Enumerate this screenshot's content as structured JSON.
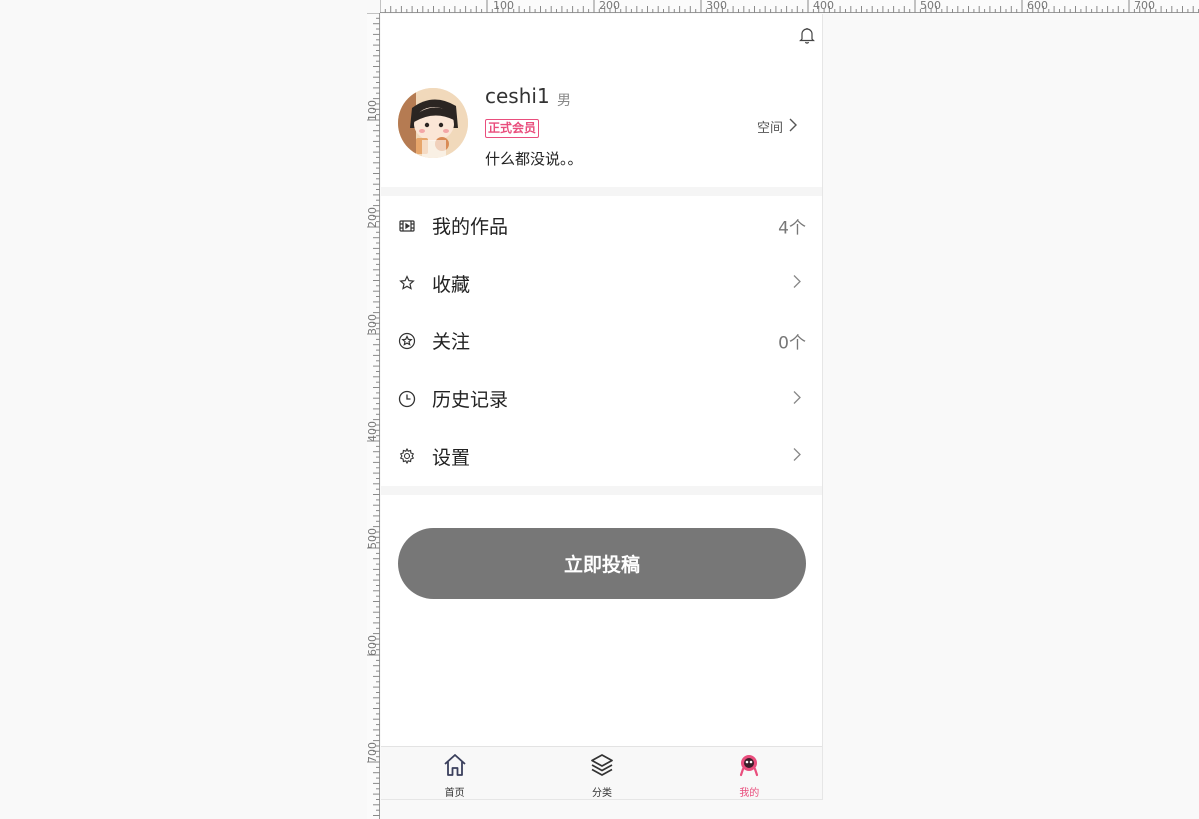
{
  "ruler": {
    "top": [
      "100",
      "200",
      "300",
      "400",
      "500",
      "600",
      "700"
    ],
    "left": [
      "100",
      "200",
      "300",
      "400",
      "500",
      "600",
      "700"
    ]
  },
  "header": {
    "bell_icon": "bell-icon"
  },
  "profile": {
    "username": "ceshi1",
    "gender": "男",
    "member_badge": "正式会员",
    "bio": "什么都没说。。",
    "space_label": "空间"
  },
  "menu": {
    "items": [
      {
        "icon": "film-icon",
        "label": "我的作品",
        "right": "4个"
      },
      {
        "icon": "star-icon",
        "label": "收藏",
        "right": ""
      },
      {
        "icon": "star-circle-icon",
        "label": "关注",
        "right": "0个"
      },
      {
        "icon": "clock-icon",
        "label": "历史记录",
        "right": ""
      },
      {
        "icon": "gear-icon",
        "label": "设置",
        "right": ""
      }
    ]
  },
  "submit_button": "立即投稿",
  "tabbar": {
    "tabs": [
      {
        "icon": "home-icon",
        "label": "首页"
      },
      {
        "icon": "layers-icon",
        "label": "分类"
      },
      {
        "icon": "user-icon",
        "label": "我的",
        "active": true
      }
    ]
  },
  "colors": {
    "accent": "#e94e7d",
    "button": "#777777"
  }
}
